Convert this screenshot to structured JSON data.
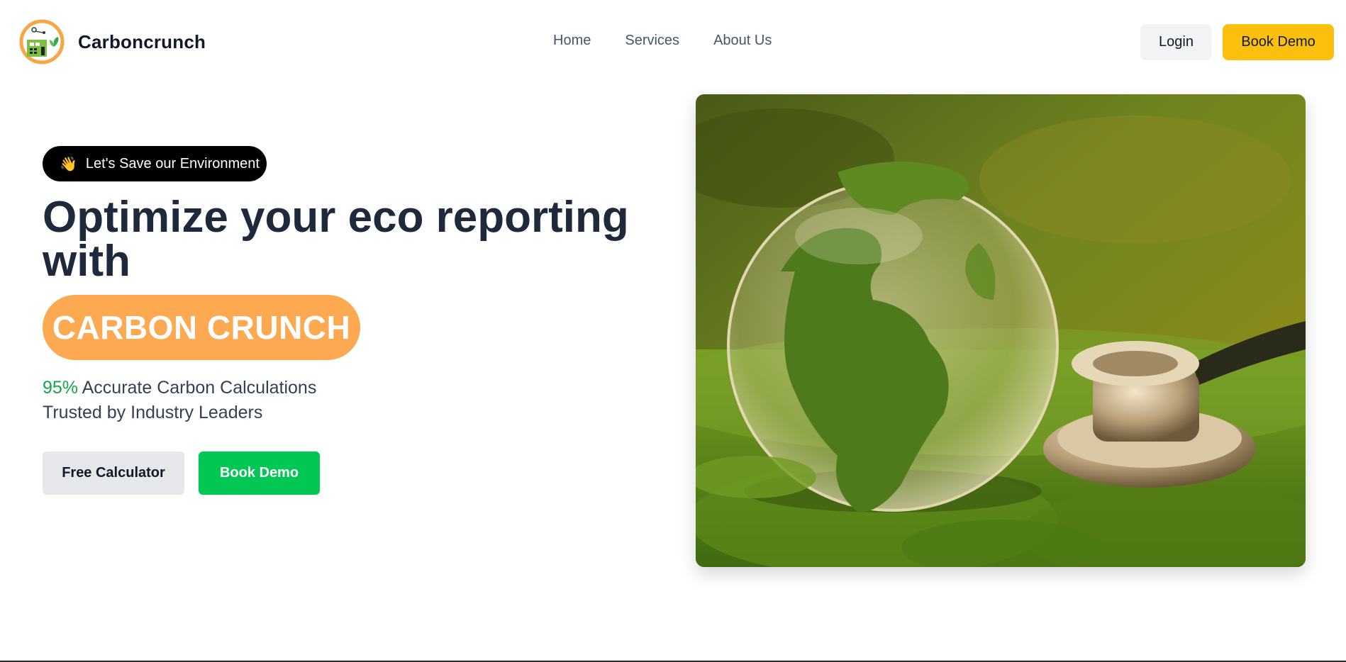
{
  "header": {
    "brand": "Carboncrunch",
    "nav": [
      "Home",
      "Services",
      "About Us"
    ],
    "login_label": "Login",
    "demo_label": "Book Demo"
  },
  "hero": {
    "badge_icon": "waving-hand-icon",
    "badge_text": "Let's Save our Environment",
    "headline": "Optimize your eco reporting with",
    "highlight": "CARBON CRUNCH",
    "stat_percent": "95%",
    "stat_text": " Accurate Carbon Calculations",
    "trusted_text": "Trusted by Industry Leaders",
    "calc_button": "Free Calculator",
    "demo_button": "Book Demo",
    "image_icon": "globe-with-stethoscope-image"
  },
  "colors": {
    "accent_yellow": "#fbbf0d",
    "accent_orange": "#fca952",
    "accent_green": "#02c853",
    "text_dark": "#1e293b"
  }
}
